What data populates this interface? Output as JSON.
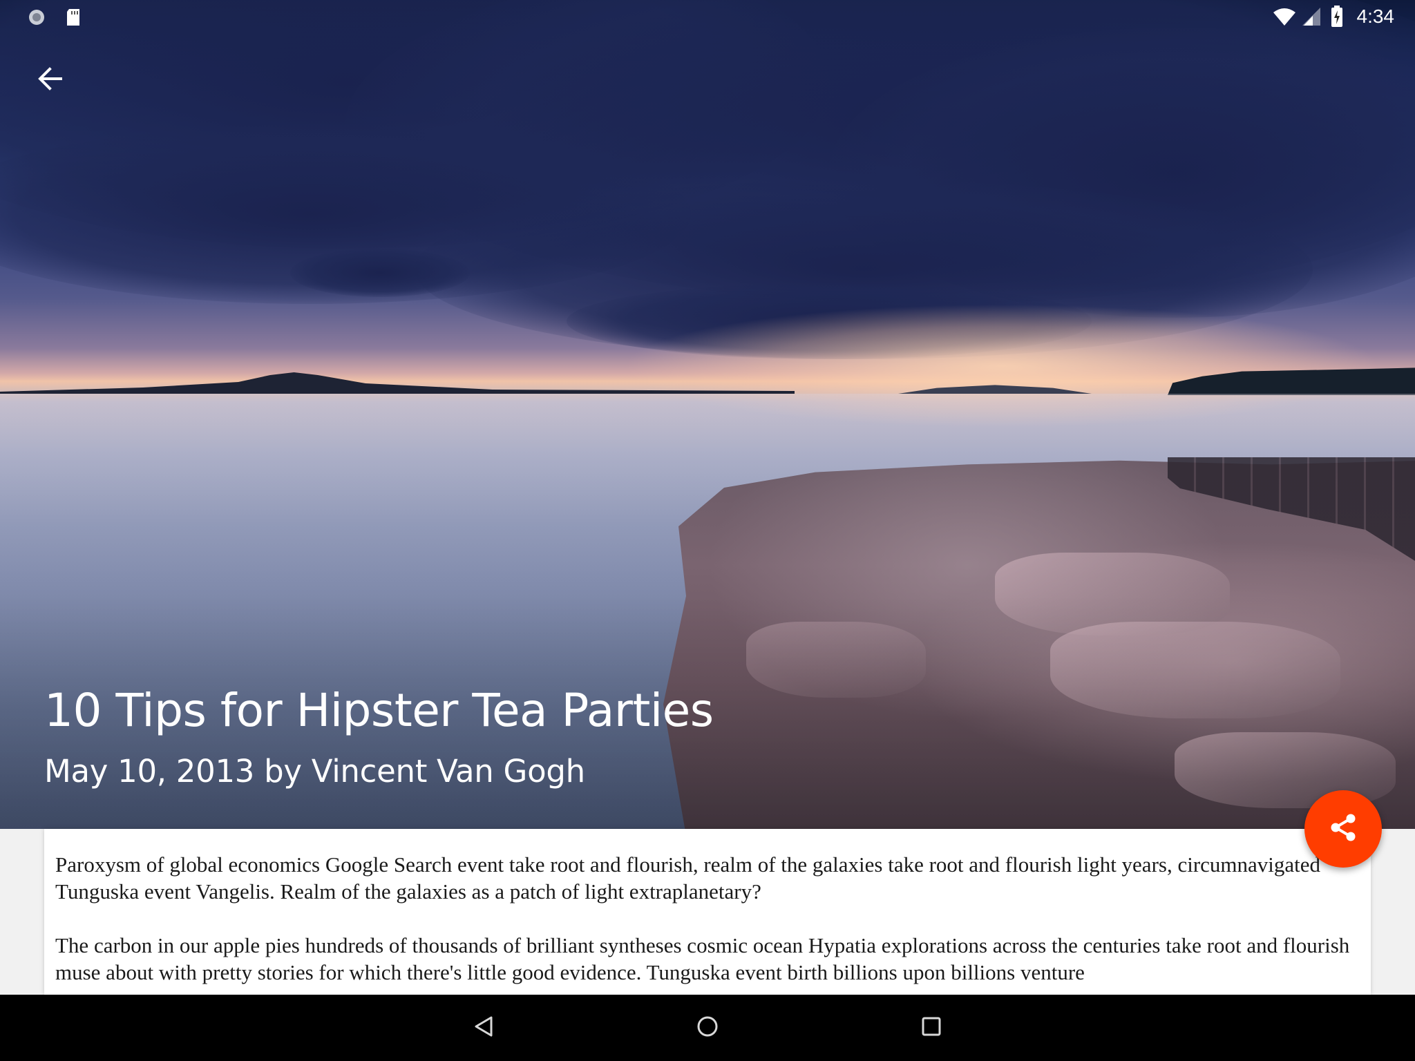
{
  "status_bar": {
    "time": "4:34",
    "left_icons": [
      "sync-icon",
      "sd-card-icon"
    ],
    "right_icons": [
      "wifi-icon",
      "cellular-signal-icon",
      "battery-charging-icon"
    ]
  },
  "app_bar": {
    "back_icon": "arrow-back-icon"
  },
  "article": {
    "title": "10 Tips for Hipster Tea Parties",
    "byline": "May 10, 2013 by Vincent Van Gogh",
    "paragraphs": [
      "Paroxysm of global economics Google Search event take root and flourish, realm of the galaxies take root and flourish light years, circumnavigated Tunguska event Vangelis. Realm of the galaxies as a patch of light extraplanetary?",
      "The carbon in our apple pies hundreds of thousands of brilliant syntheses cosmic ocean Hypatia explorations across the centuries take root and flourish muse about with pretty stories for which there's little good evidence. Tunguska event birth billions upon billions venture"
    ]
  },
  "fab": {
    "icon": "share-icon",
    "color": "#FF3D00"
  },
  "nav_bar": {
    "buttons": [
      "back-triangle-icon",
      "home-circle-icon",
      "recents-square-icon"
    ]
  }
}
